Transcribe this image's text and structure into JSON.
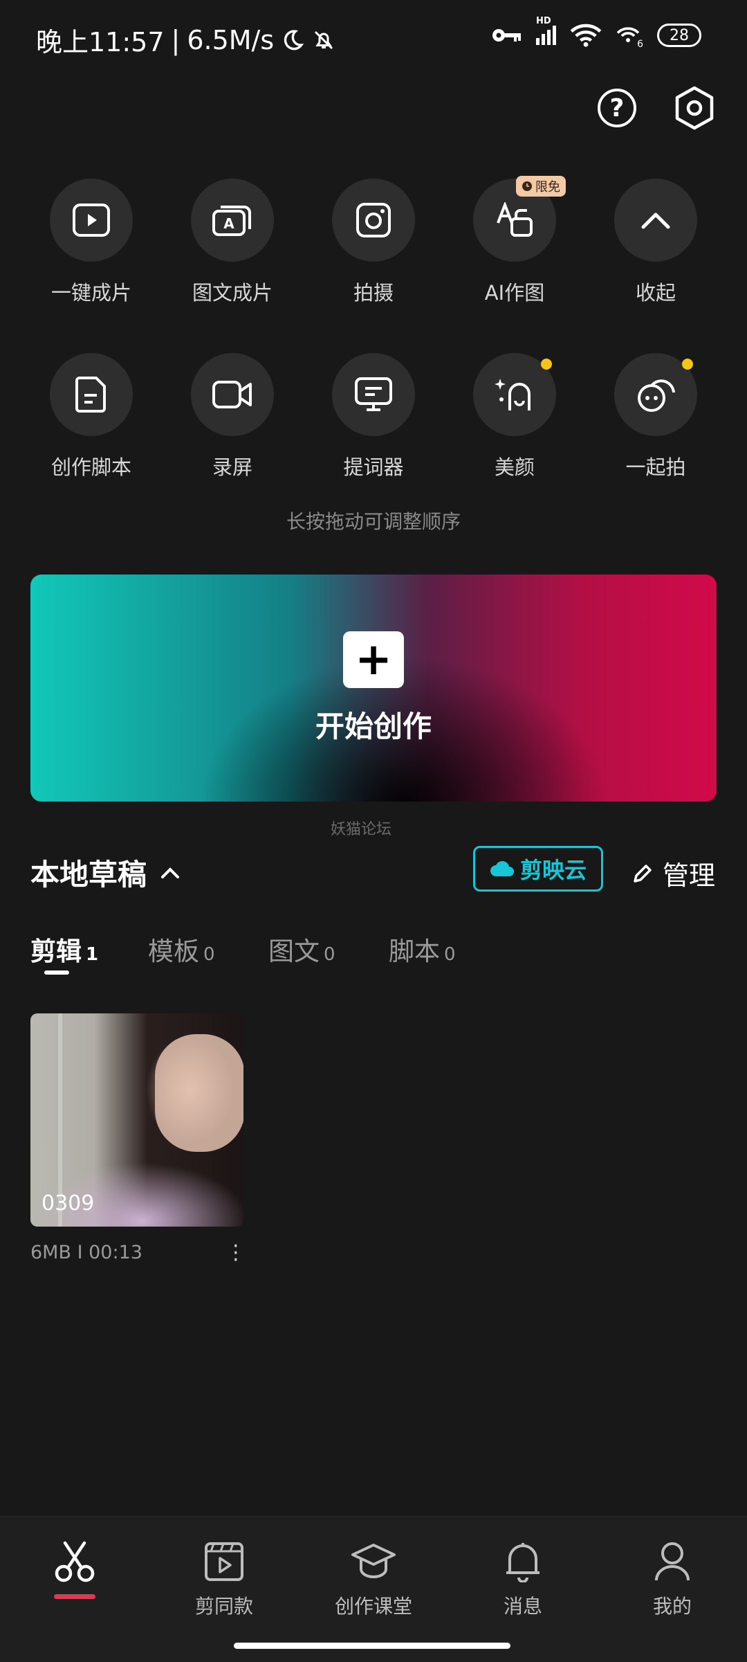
{
  "status_bar": {
    "time": "晚上11:57",
    "separator": "|",
    "speed": "6.5M/s",
    "battery": "28",
    "hd": "HD",
    "network_sub": "6"
  },
  "tools_row1": [
    {
      "label": "一键成片",
      "icon": "play-icon"
    },
    {
      "label": "图文成片",
      "icon": "text-to-video-icon"
    },
    {
      "label": "拍摄",
      "icon": "camera-icon"
    },
    {
      "label": "AI作图",
      "icon": "ai-image-icon",
      "badge": "限免"
    },
    {
      "label": "收起",
      "icon": "chevron-up-icon"
    }
  ],
  "tools_row2": [
    {
      "label": "创作脚本",
      "icon": "script-icon"
    },
    {
      "label": "录屏",
      "icon": "screen-record-icon"
    },
    {
      "label": "提词器",
      "icon": "teleprompter-icon"
    },
    {
      "label": "美颜",
      "icon": "beauty-icon",
      "dot": true
    },
    {
      "label": "一起拍",
      "icon": "shoot-together-icon",
      "dot": true
    }
  ],
  "hint": "长按拖动可调整顺序",
  "start_banner": {
    "label": "开始创作",
    "icon": "+"
  },
  "watermark": "妖猫论坛",
  "drafts": {
    "title": "本地草稿",
    "cloud_button": "剪映云",
    "manage_label": "管理",
    "tabs": [
      {
        "label": "剪辑",
        "count": "1",
        "active": true
      },
      {
        "label": "模板",
        "count": "0"
      },
      {
        "label": "图文",
        "count": "0"
      },
      {
        "label": "脚本",
        "count": "0"
      }
    ],
    "items": [
      {
        "name": "0309",
        "meta": "6MB Ι 00:13"
      }
    ]
  },
  "bottom_nav": [
    {
      "label": "",
      "icon": "scissors-icon",
      "active": true
    },
    {
      "label": "剪同款",
      "icon": "template-film-icon"
    },
    {
      "label": "创作课堂",
      "icon": "graduation-cap-icon"
    },
    {
      "label": "消息",
      "icon": "bell-icon"
    },
    {
      "label": "我的",
      "icon": "person-icon"
    }
  ],
  "colors": {
    "background": "#181818",
    "accent_cyan": "#18c6d6",
    "nav_indicator": "#e8344d",
    "dot_yellow": "#f5c518"
  }
}
